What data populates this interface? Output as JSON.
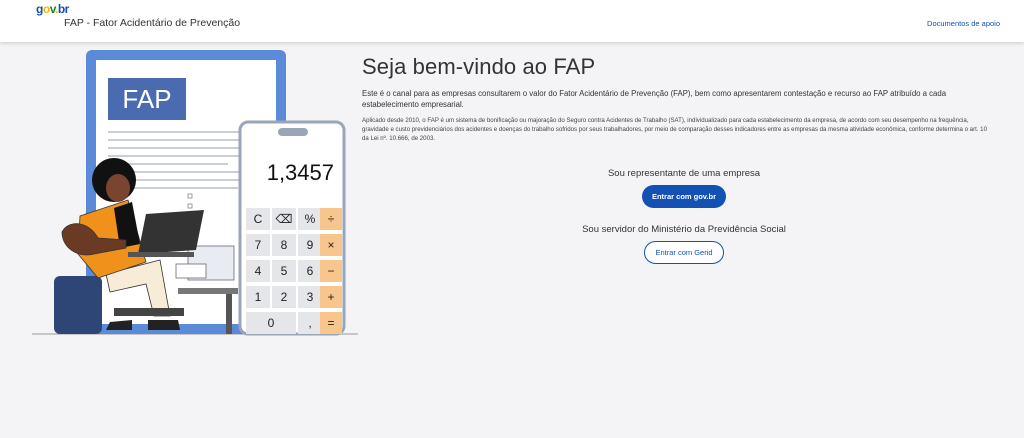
{
  "header": {
    "logo": {
      "g": "g",
      "o": "o",
      "v": "v",
      "dot": ".",
      "b": "b",
      "r": "r"
    },
    "app_title": "FAP - Fator Acidentário de Prevenção",
    "documents_link": "Documentos de apoio"
  },
  "illustration": {
    "sign_text": "FAP",
    "calculator_display": "1,3457",
    "calculator_keys": [
      "C",
      "⌫",
      "%",
      "÷",
      "7",
      "8",
      "9",
      "×",
      "4",
      "5",
      "6",
      "−",
      "1",
      "2",
      "3",
      "+",
      "0",
      ",",
      "="
    ],
    "colors": {
      "page_frame": "#5b8bd8",
      "fap_box": "#4a6bb0",
      "calc_accent": "#f8c58c",
      "shirt": "#f0911c",
      "stool": "#2d4675"
    }
  },
  "main": {
    "welcome_title": "Seja bem-vindo ao FAP",
    "intro_text": "Este é o canal para as empresas consultarem o valor do Fator Acidentário de Prevenção (FAP), bem como apresentarem contestação e recurso ao FAP atribuído a cada estabelecimento empresarial.",
    "detail_text": "Aplicado desde 2010, o FAP é um sistema de bonificação ou majoração do Seguro contra Acidentes de Trabalho (SAT), individualizado para cada estabelecimento da empresa, de acordo com seu desempenho na frequência, gravidade e custo previdenciários dos acidentes e doenças do trabalho sofridos por seus trabalhadores, por meio de comparação desses indicadores entre as empresas da mesma atividade econômica, conforme determina o art. 10 da Lei nº. 10.666, de 2003."
  },
  "company_section": {
    "title": "Sou representante de uma empresa",
    "button_label": "Entrar com gov.br"
  },
  "ministry_section": {
    "title": "Sou servidor do Ministério da Previdência Social",
    "button_label": "Entrar com Gerid"
  },
  "colors": {
    "primary": "#1351b4",
    "background": "#f4f4f6"
  }
}
